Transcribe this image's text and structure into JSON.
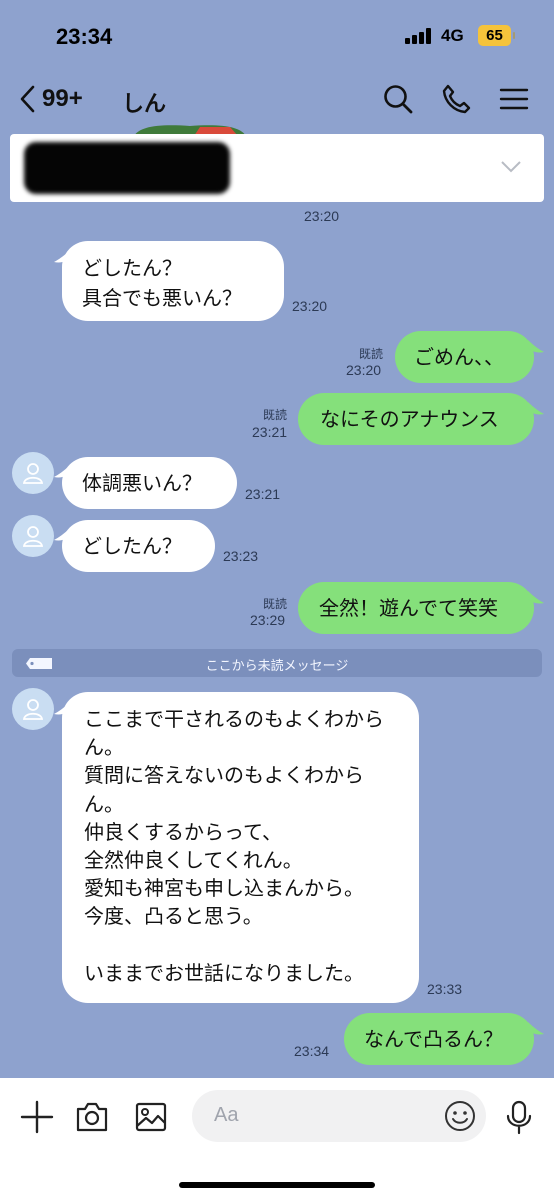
{
  "status_bar": {
    "time": "23:34",
    "network": "4G",
    "battery": "65"
  },
  "header": {
    "back_count": "99+",
    "title": "しん"
  },
  "messages": [
    {
      "side": "in",
      "lines": [
        "どしたん？",
        "具合でも悪いん？"
      ],
      "time": "23:20"
    },
    {
      "side": "out",
      "text": "ごめん、、",
      "read": "既読",
      "time": "23:20"
    },
    {
      "side": "out",
      "text": "なにそのアナウンス",
      "read": "既読",
      "time": "23:21"
    },
    {
      "side": "in",
      "text": "体調悪いん？",
      "time": "23:21"
    },
    {
      "side": "in",
      "text": "どしたん？",
      "time": "23:23"
    },
    {
      "side": "out",
      "text": "全然！遊んでて笑笑",
      "read": "既読",
      "time": "23:29"
    },
    {
      "side": "in",
      "lines": [
        "ここまで干されるのもよくわから",
        "ん。",
        "質問に答えないのもよくわから",
        "ん。",
        "仲良くするからって、",
        "全然仲良くしてくれん。",
        "愛知も神宮も申し込まんから。",
        "今度、凸ると思う。",
        "",
        "いままでお世話になりました。"
      ],
      "time": "23:33"
    },
    {
      "side": "out",
      "text": "なんで凸るん？",
      "time": "23:34"
    }
  ],
  "pinned_time": "23:20",
  "unread_divider": "ここから未読メッセージ",
  "input": {
    "placeholder": "Aa"
  },
  "colors": {
    "background": "#8ea2ce",
    "outgoing": "#85e07b",
    "incoming": "#ffffff",
    "battery": "#f5c33b"
  }
}
